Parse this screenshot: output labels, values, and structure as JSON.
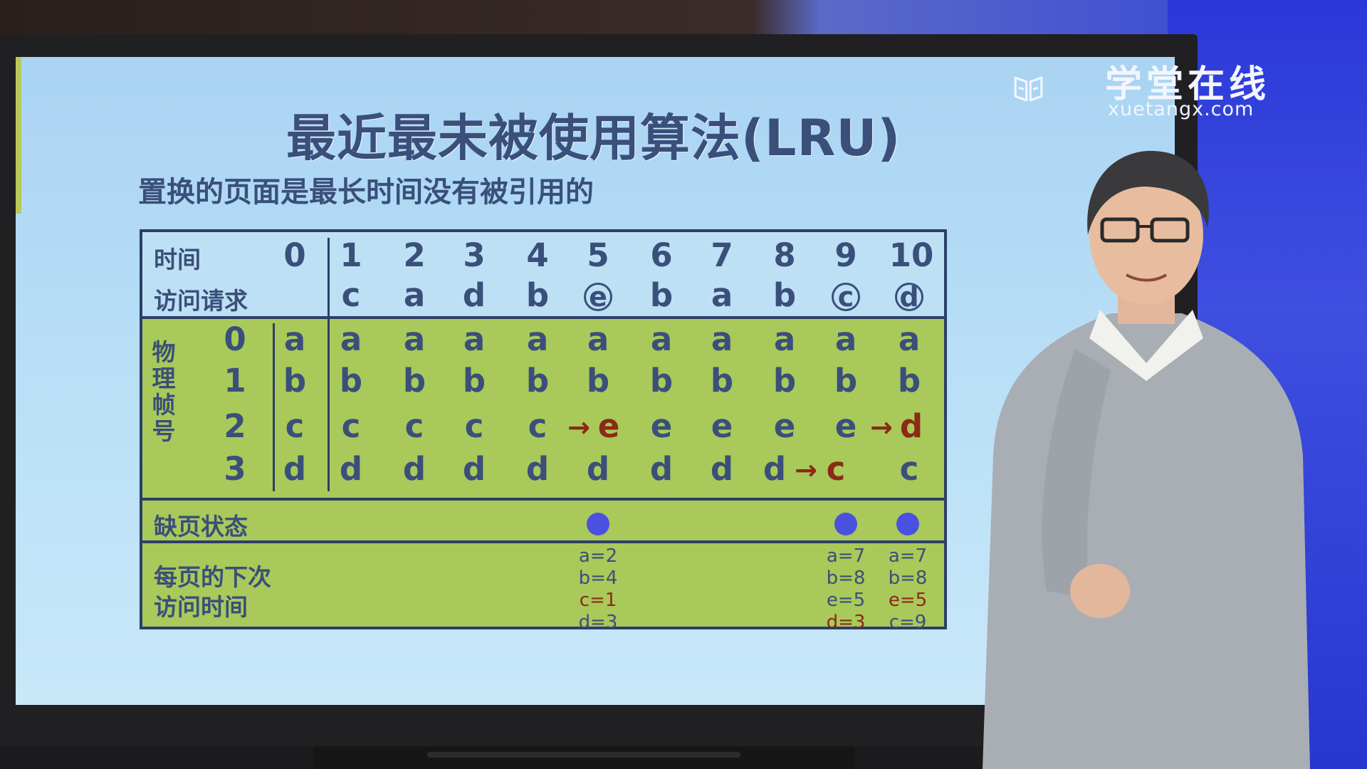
{
  "slide": {
    "title": "最近最未被使用算法(LRU)",
    "subtitle": "置换的页面是最长时间没有被引用的"
  },
  "table": {
    "time_label": "时间",
    "request_label": "访问请求",
    "frames_label": "物理帧号",
    "fault_label": "缺页状态",
    "next_label_1": "每页的下次",
    "next_label_2": "访问时间",
    "times": [
      "0",
      "1",
      "2",
      "3",
      "4",
      "5",
      "6",
      "7",
      "8",
      "9",
      "10"
    ],
    "requests": [
      "c",
      "a",
      "d",
      "b",
      "e",
      "b",
      "a",
      "b",
      "c",
      "d"
    ],
    "frame_ids": [
      "0",
      "1",
      "2",
      "3"
    ],
    "initial": [
      "a",
      "b",
      "c",
      "d"
    ],
    "frames": [
      [
        "a",
        "a",
        "a",
        "a",
        "a",
        "a",
        "a",
        "a",
        "a",
        "a"
      ],
      [
        "b",
        "b",
        "b",
        "b",
        "b",
        "b",
        "b",
        "b",
        "b",
        "b"
      ],
      [
        "c",
        "c",
        "c",
        "c",
        "e",
        "e",
        "e",
        "e",
        "e",
        "d"
      ],
      [
        "d",
        "d",
        "d",
        "d",
        "d",
        "d",
        "d",
        "d",
        "c",
        "c"
      ]
    ],
    "arrow": "→",
    "next_access": {
      "t5": [
        "a=2",
        "b=4",
        "c=1",
        "d=3"
      ],
      "t9": [
        "a=7",
        "b=8",
        "e=5",
        "d=3"
      ],
      "t10": [
        "a=7",
        "b=8",
        "e=5",
        "c=9"
      ]
    }
  },
  "watermark": {
    "name": "学堂在线",
    "url": "xuetangx.com"
  }
}
